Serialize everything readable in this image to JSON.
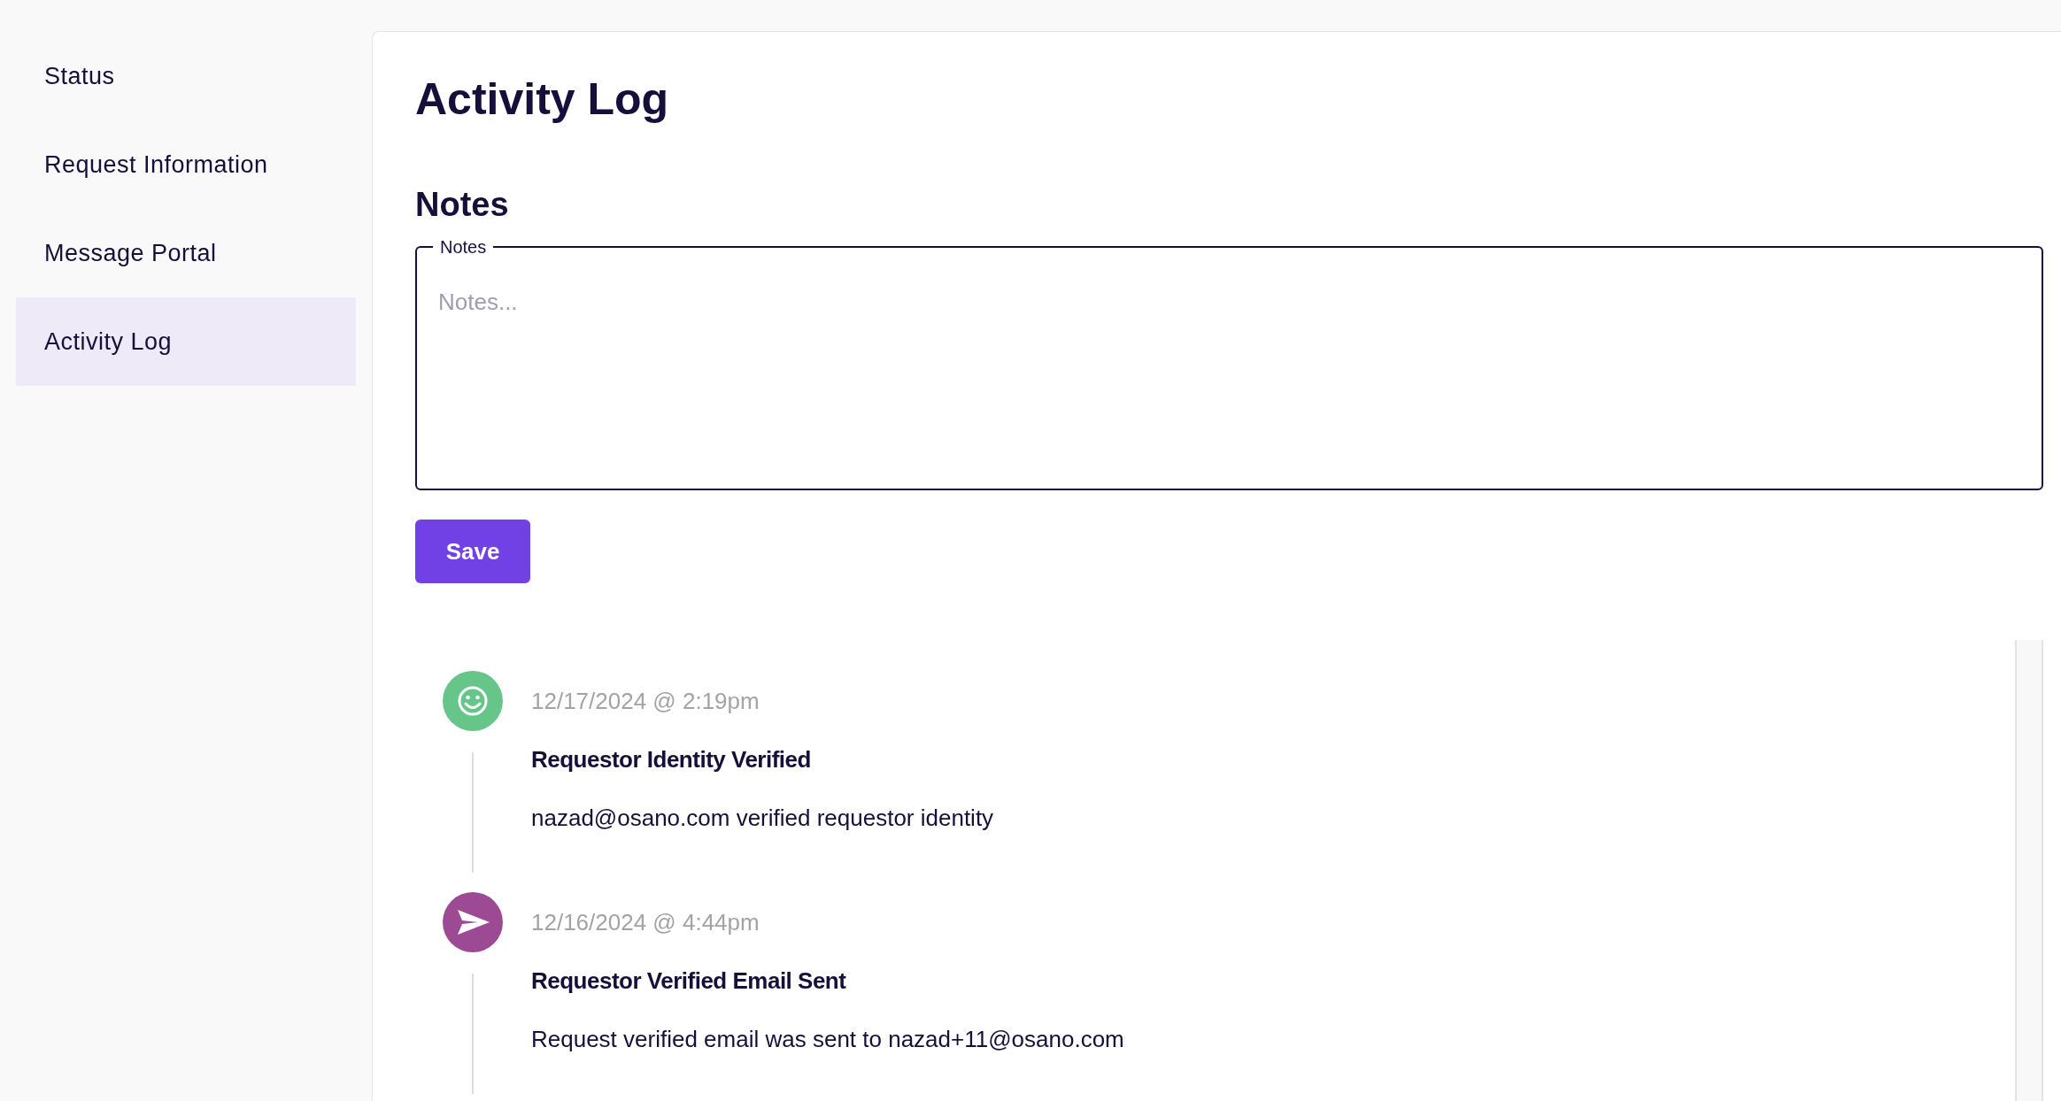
{
  "sidebar": {
    "items": [
      {
        "label": "Status",
        "selected": false
      },
      {
        "label": "Request Information",
        "selected": false
      },
      {
        "label": "Message Portal",
        "selected": false
      },
      {
        "label": "Activity Log",
        "selected": true
      }
    ]
  },
  "page_title": "Activity Log",
  "notes": {
    "heading": "Notes",
    "field_label": "Notes",
    "placeholder": "Notes...",
    "save_button": "Save"
  },
  "activity": [
    {
      "kind": "verified",
      "timestamp": "12/17/2024 @ 2:19pm",
      "title": "Requestor Identity Verified",
      "description": "nazad@osano.com verified requestor identity"
    },
    {
      "kind": "email",
      "timestamp": "12/16/2024 @ 4:44pm",
      "title": "Requestor Verified Email Sent",
      "description": "Request verified email was sent to nazad+11@osano.com"
    }
  ]
}
